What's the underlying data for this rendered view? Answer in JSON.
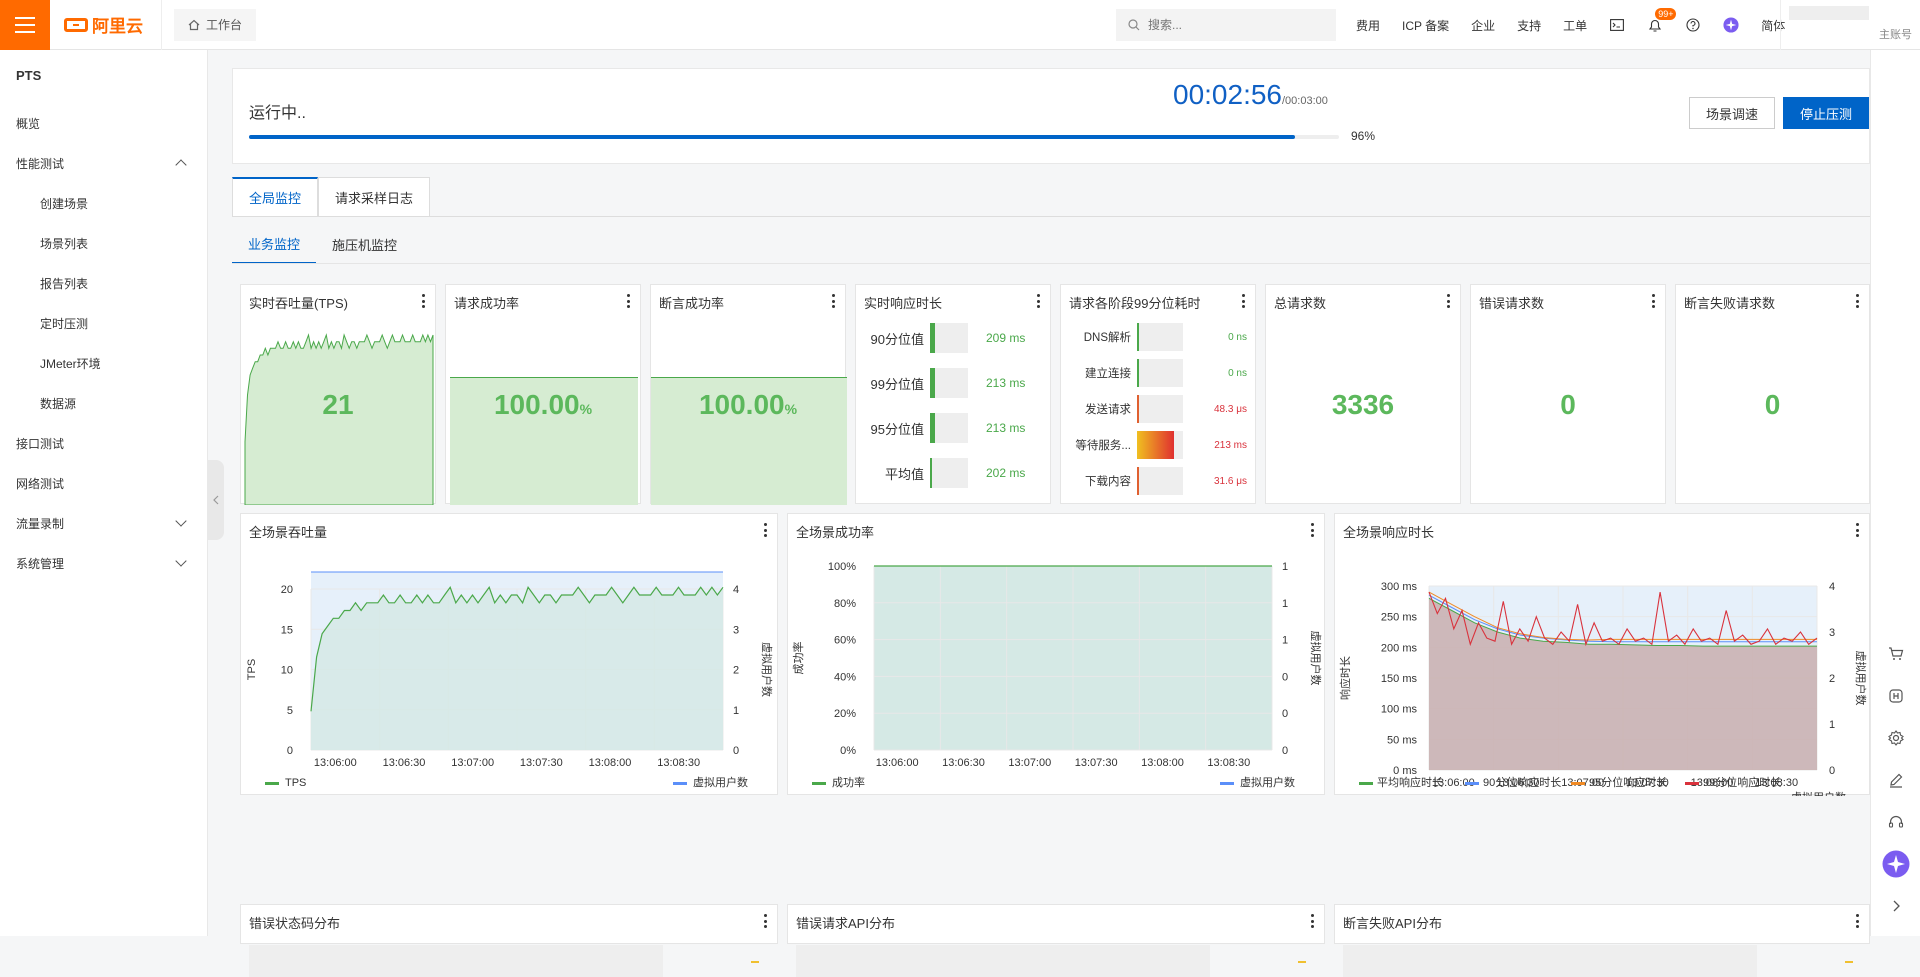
{
  "topbar": {
    "logo_text": "阿里云",
    "workbench": "工作台",
    "search_placeholder": "搜索...",
    "nav": [
      "费用",
      "ICP 备案",
      "企业",
      "支持",
      "工单"
    ],
    "notif_badge": "99+",
    "lang": "简体",
    "account": "主账号"
  },
  "sidebar": {
    "title": "PTS",
    "items": [
      {
        "label": "概览"
      },
      {
        "label": "性能测试"
      },
      {
        "label": "创建场景"
      },
      {
        "label": "场景列表"
      },
      {
        "label": "报告列表"
      },
      {
        "label": "定时压测"
      },
      {
        "label": "JMeter环境"
      },
      {
        "label": "数据源"
      },
      {
        "label": "接口测试"
      },
      {
        "label": "网络测试"
      },
      {
        "label": "流量录制"
      },
      {
        "label": "系统管理"
      }
    ]
  },
  "run": {
    "status": "运行中..",
    "elapsed": "00:02:56",
    "total": "/00:03:00",
    "progress_pct": 96,
    "progress_text": "96%",
    "debug_button": "场景调速",
    "stop_button": "停止压测"
  },
  "tabs": {
    "primary": [
      "全局监控",
      "请求采样日志"
    ],
    "secondary": [
      "业务监控",
      "施压机监控"
    ]
  },
  "kpi": {
    "tps_title": "实时吞吐量(TPS)",
    "tps_value": "21",
    "success_title": "请求成功率",
    "success_value": "100.00",
    "success_unit": "%",
    "assert_title": "断言成功率",
    "assert_value": "100.00",
    "assert_unit": "%",
    "rt_title": "实时响应时长",
    "rt_rows": [
      {
        "label": "90分位值",
        "value": "209 ms",
        "fill": 0.12
      },
      {
        "label": "99分位值",
        "value": "213 ms",
        "fill": 0.12
      },
      {
        "label": "95分位值",
        "value": "213 ms",
        "fill": 0.12
      },
      {
        "label": "平均值",
        "value": "202 ms",
        "fill": 0.04
      }
    ],
    "stage_title": "请求各阶段99分位耗时",
    "stage_rows": [
      {
        "label": "DNS解析",
        "value": "0 ns",
        "fill": 0.04,
        "color": "#4aa84a"
      },
      {
        "label": "建立连接",
        "value": "0 ns",
        "fill": 0.04,
        "color": "#4aa84a"
      },
      {
        "label": "发送请求",
        "value": "48.3 μs",
        "fill": 0.04,
        "color": "#e06030"
      },
      {
        "label": "等待服务...",
        "value": "213 ms",
        "fill": 0.8,
        "color": "#e8a020"
      },
      {
        "label": "下载内容",
        "value": "31.6 μs",
        "fill": 0.04,
        "color": "#e06030"
      }
    ],
    "total_title": "总请求数",
    "total_value": "3336",
    "error_title": "错误请求数",
    "error_value": "0",
    "assert_fail_title": "断言失败请求数",
    "assert_fail_value": "0"
  },
  "charts": {
    "tps_title": "全场景吞吐量",
    "success_title": "全场景成功率",
    "rt_title": "全场景响应时长",
    "err_code_title": "错误状态码分布",
    "err_api_title": "错误请求API分布",
    "assert_api_title": "断言失败API分布"
  },
  "chart_data": [
    {
      "type": "line",
      "title": "全场景吞吐量",
      "ylabel": "TPS",
      "y2label": "虚拟用户数",
      "x": [
        "13:06:00",
        "13:06:30",
        "13:07:00",
        "13:07:30",
        "13:08:00",
        "13:08:30"
      ],
      "yticks": [
        0,
        5,
        10,
        15,
        20
      ],
      "y2ticks": [
        0,
        1,
        2,
        3,
        4
      ],
      "ylim": [
        0,
        24
      ],
      "y2lim": [
        0,
        4.4
      ],
      "series": [
        {
          "name": "TPS",
          "color": "#4aa84a",
          "values": [
            5,
            12,
            15,
            16,
            17,
            17,
            18,
            18,
            19,
            18,
            19,
            19,
            19,
            20,
            19,
            19,
            20,
            19,
            19,
            20,
            19,
            20,
            19,
            19,
            20,
            21,
            19,
            20,
            19,
            20,
            19,
            20,
            21,
            19,
            20,
            19,
            20,
            20,
            19,
            21,
            20,
            19,
            20,
            20,
            19,
            20,
            20,
            20,
            21,
            20,
            19,
            20,
            20,
            20,
            21,
            20,
            19,
            20,
            21,
            20,
            20,
            20,
            21,
            20,
            20,
            20,
            21,
            20,
            20,
            20,
            21,
            20,
            21,
            20,
            21
          ]
        },
        {
          "name": "虚拟用户数",
          "color": "#5b8ff9",
          "values": [
            4,
            4
          ]
        }
      ]
    },
    {
      "type": "area",
      "title": "全场景成功率",
      "ylabel": "成功率",
      "y2label": "虚拟用户数",
      "x": [
        "13:06:00",
        "13:06:30",
        "13:07:00",
        "13:07:30",
        "13:08:00",
        "13:08:30"
      ],
      "yticks": [
        "0%",
        "20%",
        "40%",
        "60%",
        "80%",
        "100%"
      ],
      "y2ticks": [
        "0",
        "0",
        "0",
        "1",
        "1",
        "1"
      ],
      "series": [
        {
          "name": "成功率",
          "color": "#4aa84a",
          "values": [
            100,
            100
          ]
        },
        {
          "name": "虚拟用户数",
          "color": "#5b8ff9",
          "values": [
            4,
            4
          ]
        }
      ]
    },
    {
      "type": "line",
      "title": "全场景响应时长",
      "ylabel": "响应时长",
      "y2label": "虚拟用户数",
      "x": [
        "13:06:00",
        "13:06:30",
        "13:07:00",
        "13:07:30",
        "13:08:00",
        "13:08:30"
      ],
      "yticks": [
        "0 ms",
        "50 ms",
        "100 ms",
        "150 ms",
        "200 ms",
        "250 ms",
        "300 ms"
      ],
      "y2ticks": [
        0,
        1,
        2,
        3,
        4
      ],
      "ylim": [
        0,
        300
      ],
      "series": [
        {
          "name": "平均响应时长",
          "color": "#4aa84a",
          "values": [
            280,
            260,
            240,
            225,
            215,
            210,
            208,
            205,
            205,
            204,
            203,
            203,
            202,
            202,
            202,
            202,
            202,
            202
          ]
        },
        {
          "name": "90分位响应时长",
          "color": "#5b8ff9",
          "values": [
            285,
            265,
            245,
            230,
            220,
            215,
            212,
            210,
            209,
            209,
            209,
            209,
            209,
            209,
            209,
            209,
            209,
            209
          ]
        },
        {
          "name": "95分位响应时长",
          "color": "#f08a24",
          "values": [
            290,
            270,
            250,
            232,
            222,
            216,
            213,
            212,
            213,
            213,
            213,
            213,
            213,
            213,
            213,
            213,
            213,
            213
          ]
        },
        {
          "name": "99分位响应时长",
          "color": "#d9323c",
          "values": [
            290,
            255,
            280,
            230,
            260,
            205,
            240,
            215,
            210,
            275,
            205,
            230,
            210,
            250,
            215,
            205,
            225,
            210,
            270,
            205,
            240,
            210,
            215,
            205,
            230,
            210,
            215,
            205,
            290,
            210,
            220,
            205,
            230,
            210,
            215,
            205,
            260,
            210,
            220,
            205,
            210,
            230,
            205,
            215,
            210,
            225,
            205,
            215
          ]
        }
      ]
    }
  ],
  "right_icons": [
    "cart-icon",
    "chip-icon",
    "settings-icon",
    "edit-icon",
    "headset-icon",
    "assistant-icon",
    "chevron-right-icon"
  ]
}
